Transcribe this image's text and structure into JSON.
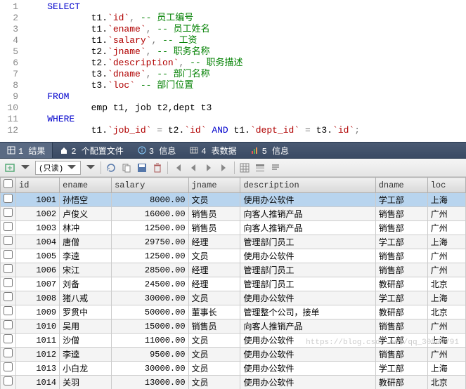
{
  "sql": {
    "lines": [
      {
        "n": 1,
        "ind": "    ",
        "t": [
          {
            "k": "kw",
            "v": "SELECT"
          }
        ]
      },
      {
        "n": 2,
        "ind": "            ",
        "t": [
          {
            "k": "",
            "v": "t1."
          },
          {
            "k": "ident",
            "v": "`id`"
          },
          {
            "k": "op",
            "v": ","
          },
          {
            "k": "",
            "v": " "
          },
          {
            "k": "cm",
            "v": "-- 员工编号"
          }
        ]
      },
      {
        "n": 3,
        "ind": "            ",
        "t": [
          {
            "k": "",
            "v": "t1."
          },
          {
            "k": "ident",
            "v": "`ename`"
          },
          {
            "k": "op",
            "v": ","
          },
          {
            "k": "",
            "v": " "
          },
          {
            "k": "cm",
            "v": "-- 员工姓名"
          }
        ]
      },
      {
        "n": 4,
        "ind": "            ",
        "t": [
          {
            "k": "",
            "v": "t1."
          },
          {
            "k": "ident",
            "v": "`salary`"
          },
          {
            "k": "op",
            "v": ","
          },
          {
            "k": "",
            "v": " "
          },
          {
            "k": "cm",
            "v": "-- 工资"
          }
        ]
      },
      {
        "n": 5,
        "ind": "            ",
        "t": [
          {
            "k": "",
            "v": "t2."
          },
          {
            "k": "ident",
            "v": "`jname`"
          },
          {
            "k": "op",
            "v": ","
          },
          {
            "k": "",
            "v": " "
          },
          {
            "k": "cm",
            "v": "-- 职务名称"
          }
        ]
      },
      {
        "n": 6,
        "ind": "            ",
        "t": [
          {
            "k": "",
            "v": "t2."
          },
          {
            "k": "ident",
            "v": "`description`"
          },
          {
            "k": "op",
            "v": ","
          },
          {
            "k": "",
            "v": " "
          },
          {
            "k": "cm",
            "v": "-- 职务描述"
          }
        ]
      },
      {
        "n": 7,
        "ind": "            ",
        "t": [
          {
            "k": "",
            "v": "t3."
          },
          {
            "k": "ident",
            "v": "`dname`"
          },
          {
            "k": "op",
            "v": ","
          },
          {
            "k": "",
            "v": " "
          },
          {
            "k": "cm",
            "v": "-- 部门名称"
          }
        ]
      },
      {
        "n": 8,
        "ind": "            ",
        "t": [
          {
            "k": "",
            "v": "t3."
          },
          {
            "k": "ident",
            "v": "`loc`"
          },
          {
            "k": "",
            "v": " "
          },
          {
            "k": "cm",
            "v": "-- 部门位置"
          }
        ]
      },
      {
        "n": 9,
        "ind": "    ",
        "t": [
          {
            "k": "kw",
            "v": "FROM"
          }
        ]
      },
      {
        "n": 10,
        "ind": "            ",
        "t": [
          {
            "k": "",
            "v": "emp t1, job t2,dept t3"
          }
        ]
      },
      {
        "n": 11,
        "ind": "    ",
        "t": [
          {
            "k": "kw",
            "v": "WHERE"
          }
        ]
      },
      {
        "n": 12,
        "ind": "            ",
        "t": [
          {
            "k": "",
            "v": "t1."
          },
          {
            "k": "ident",
            "v": "`job_id`"
          },
          {
            "k": "",
            "v": " "
          },
          {
            "k": "op",
            "v": "="
          },
          {
            "k": "",
            "v": " t2."
          },
          {
            "k": "ident",
            "v": "`id`"
          },
          {
            "k": "",
            "v": " "
          },
          {
            "k": "kw",
            "v": "AND"
          },
          {
            "k": "",
            "v": " t1."
          },
          {
            "k": "ident",
            "v": "`dept_id`"
          },
          {
            "k": "",
            "v": " "
          },
          {
            "k": "op",
            "v": "="
          },
          {
            "k": "",
            "v": " t3."
          },
          {
            "k": "ident",
            "v": "`id`"
          },
          {
            "k": "op",
            "v": ";"
          }
        ]
      }
    ]
  },
  "tabs": [
    {
      "icon": "grid",
      "label": "1 结果",
      "active": true
    },
    {
      "icon": "home",
      "label": "2 个配置文件"
    },
    {
      "icon": "info",
      "label": "3 信息"
    },
    {
      "icon": "table",
      "label": "4 表数据"
    },
    {
      "icon": "chart",
      "label": "5 信息"
    }
  ],
  "toolbar": {
    "mode": "(只读)"
  },
  "grid": {
    "headers": [
      "id",
      "ename",
      "salary",
      "jname",
      "description",
      "dname",
      "loc"
    ],
    "rows": [
      {
        "id": "1001",
        "ename": "孙悟空",
        "salary": "8000.00",
        "jname": "文员",
        "description": "使用办公软件",
        "dname": "学工部",
        "loc": "上海",
        "sel": true
      },
      {
        "id": "1002",
        "ename": "卢俊义",
        "salary": "16000.00",
        "jname": "销售员",
        "description": "向客人推销产品",
        "dname": "销售部",
        "loc": "广州"
      },
      {
        "id": "1003",
        "ename": "林冲",
        "salary": "12500.00",
        "jname": "销售员",
        "description": "向客人推销产品",
        "dname": "销售部",
        "loc": "广州"
      },
      {
        "id": "1004",
        "ename": "唐僧",
        "salary": "29750.00",
        "jname": "经理",
        "description": "管理部门员工",
        "dname": "学工部",
        "loc": "上海"
      },
      {
        "id": "1005",
        "ename": "李逵",
        "salary": "12500.00",
        "jname": "文员",
        "description": "使用办公软件",
        "dname": "销售部",
        "loc": "广州"
      },
      {
        "id": "1006",
        "ename": "宋江",
        "salary": "28500.00",
        "jname": "经理",
        "description": "管理部门员工",
        "dname": "销售部",
        "loc": "广州"
      },
      {
        "id": "1007",
        "ename": "刘备",
        "salary": "24500.00",
        "jname": "经理",
        "description": "管理部门员工",
        "dname": "教研部",
        "loc": "北京"
      },
      {
        "id": "1008",
        "ename": "猪八戒",
        "salary": "30000.00",
        "jname": "文员",
        "description": "使用办公软件",
        "dname": "学工部",
        "loc": "上海"
      },
      {
        "id": "1009",
        "ename": "罗贯中",
        "salary": "50000.00",
        "jname": "董事长",
        "description": "管理整个公司，接单",
        "dname": "教研部",
        "loc": "北京"
      },
      {
        "id": "1010",
        "ename": "吴用",
        "salary": "15000.00",
        "jname": "销售员",
        "description": "向客人推销产品",
        "dname": "销售部",
        "loc": "广州"
      },
      {
        "id": "1011",
        "ename": "沙僧",
        "salary": "11000.00",
        "jname": "文员",
        "description": "使用办公软件",
        "dname": "学工部",
        "loc": "上海"
      },
      {
        "id": "1012",
        "ename": "李逵",
        "salary": "9500.00",
        "jname": "文员",
        "description": "使用办公软件",
        "dname": "销售部",
        "loc": "广州"
      },
      {
        "id": "1013",
        "ename": "小白龙",
        "salary": "30000.00",
        "jname": "文员",
        "description": "使用办公软件",
        "dname": "学工部",
        "loc": "上海"
      },
      {
        "id": "1014",
        "ename": "关羽",
        "salary": "13000.00",
        "jname": "文员",
        "description": "使用办公软件",
        "dname": "教研部",
        "loc": "北京"
      }
    ]
  },
  "watermark": "https://blog.csdn.net/qq_30507791"
}
